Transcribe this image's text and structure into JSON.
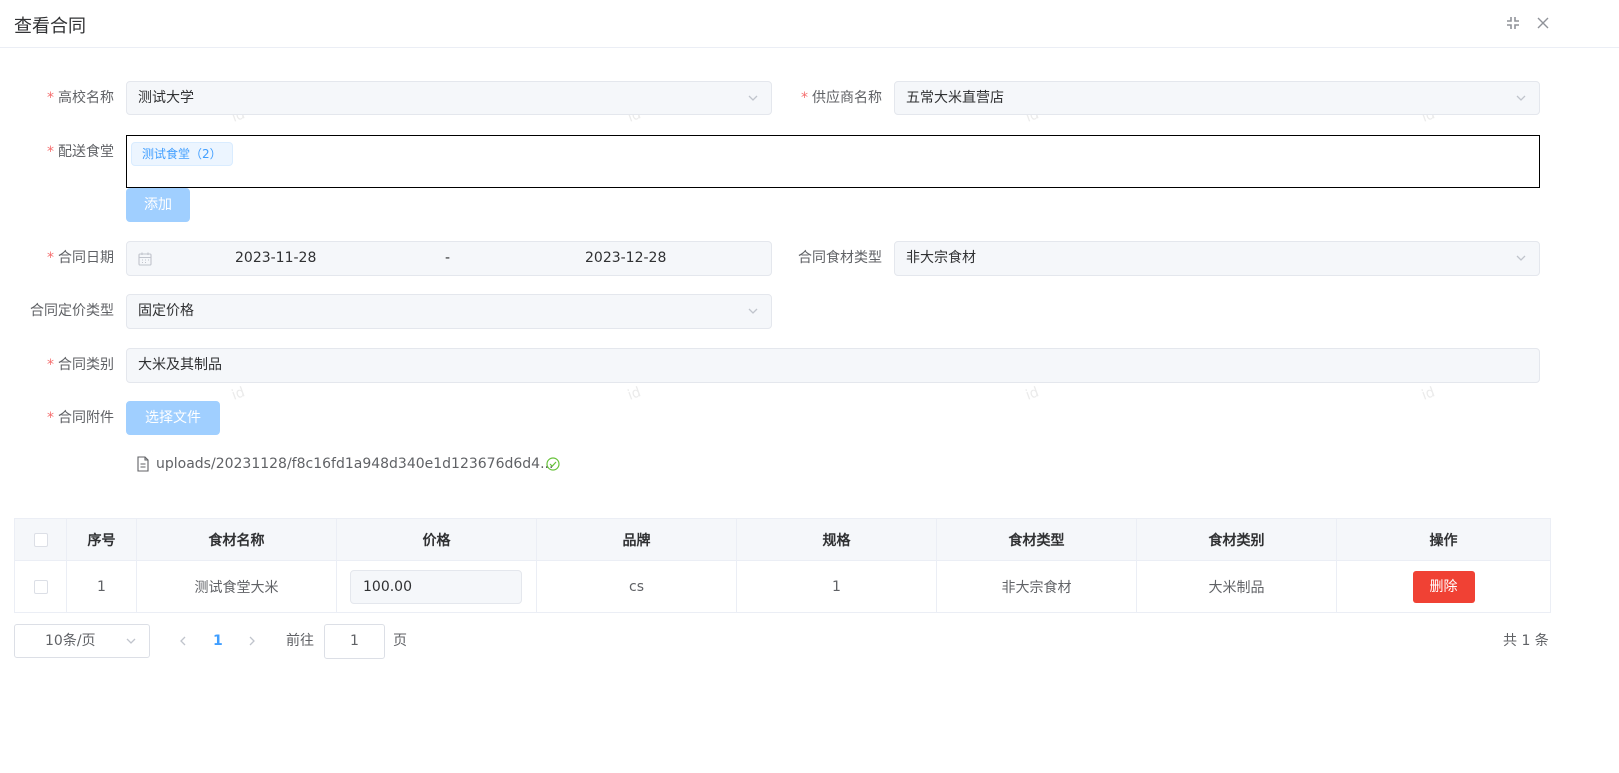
{
  "dialog": {
    "title": "查看合同"
  },
  "form": {
    "school": {
      "label": "高校名称",
      "value": "测试大学"
    },
    "supplier": {
      "label": "供应商名称",
      "value": "五常大米直营店"
    },
    "canteen": {
      "label": "配送食堂",
      "tag": "测试食堂（2）",
      "add_button": "添加"
    },
    "contract_date": {
      "label": "合同日期",
      "start": "2023-11-28",
      "separator": "-",
      "end": "2023-12-28"
    },
    "food_type": {
      "label": "合同食材类型",
      "value": "非大宗食材"
    },
    "pricing_type": {
      "label": "合同定价类型",
      "value": "固定价格"
    },
    "category": {
      "label": "合同类别",
      "value": "大米及其制品"
    },
    "attachment": {
      "label": "合同附件",
      "button": "选择文件",
      "file_name": "uploads/20231128/f8c16fd1a948d340e1d123676d6d4..."
    },
    "required_mark": "*"
  },
  "table": {
    "headers": [
      "序号",
      "食材名称",
      "价格",
      "品牌",
      "规格",
      "食材类型",
      "食材类别",
      "操作"
    ],
    "rows": [
      {
        "index": "1",
        "name": "测试食堂大米",
        "price": "100.00",
        "brand": "cs",
        "spec": "1",
        "type": "非大宗食材",
        "category": "大米制品",
        "action": "删除"
      }
    ]
  },
  "pagination": {
    "page_size": "10条/页",
    "current_page": "1",
    "goto_label": "前往",
    "goto_value": "1",
    "page_suffix": "页",
    "total": "共 1 条"
  },
  "watermark": "id",
  "colors": {
    "primary": "#409eff",
    "danger": "#f04134",
    "required": "#f56c6c",
    "success": "#67c23a"
  }
}
